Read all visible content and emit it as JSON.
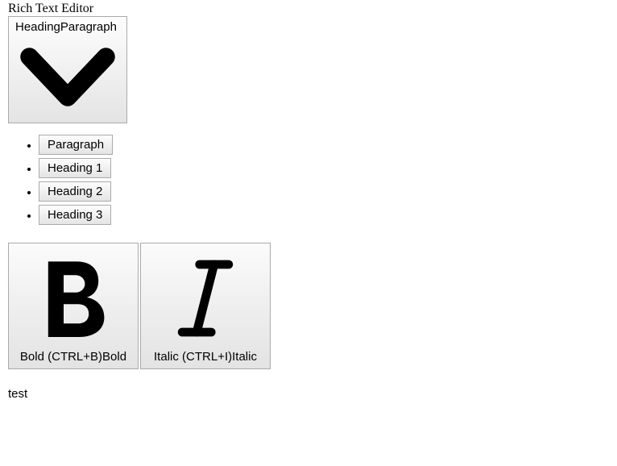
{
  "editor": {
    "label": "Rich Text Editor"
  },
  "heading_dropdown": {
    "label_prefix": "Heading",
    "current": "Paragraph",
    "options": [
      {
        "label": "Paragraph"
      },
      {
        "label": "Heading 1"
      },
      {
        "label": "Heading 2"
      },
      {
        "label": "Heading 3"
      }
    ]
  },
  "format_buttons": {
    "bold": {
      "tooltip": "Bold (CTRL+B)",
      "label": "Bold"
    },
    "italic": {
      "tooltip": "Italic (CTRL+I)",
      "label": "Italic"
    }
  },
  "content": {
    "text": "test"
  }
}
